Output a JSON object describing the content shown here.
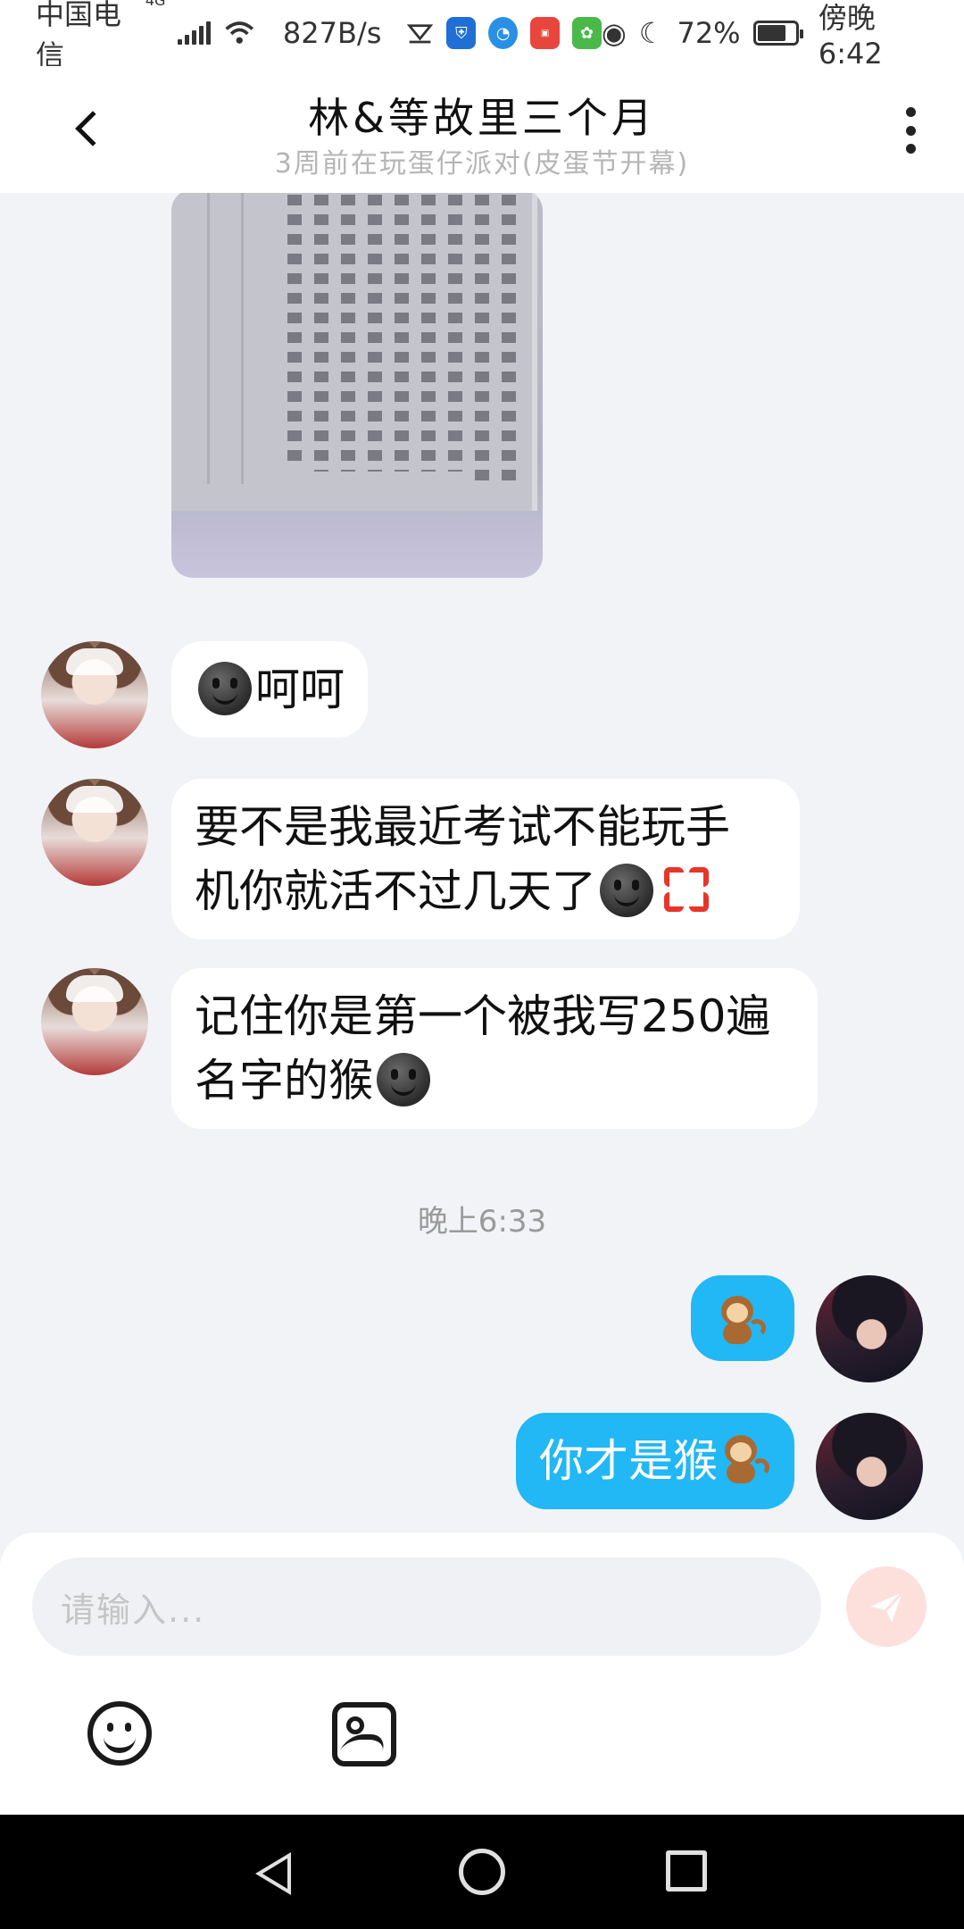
{
  "status_bar": {
    "carrier": "中国电信",
    "network_type": "4G",
    "data_speed": "827B/s",
    "battery_percent": "72%",
    "time": "傍晚6:42",
    "icons": [
      "signal-icon",
      "wifi-icon",
      "notification-icon",
      "shield-app-icon",
      "browser-app-icon",
      "huawei-app-icon",
      "game-app-icon",
      "eye-icon",
      "moon-icon",
      "battery-icon"
    ]
  },
  "header": {
    "title": "林&等故里三个月",
    "subtitle": "3周前在玩蛋仔派对(皮蛋节开幕)"
  },
  "messages": [
    {
      "from": "other",
      "type": "image",
      "alt": ""
    },
    {
      "from": "other",
      "type": "text",
      "text": "呵呵",
      "emojis": [
        "smile-emoji"
      ]
    },
    {
      "from": "other",
      "type": "text",
      "text_line1": "要不是我最近考试不能玩手",
      "text_line2": "机你就活不过几天了",
      "emojis": [
        "smile-emoji",
        "anger-emoji"
      ]
    },
    {
      "from": "other",
      "type": "text",
      "text_line1": "记住你是第一个被我写250遍",
      "text_line2": "名字的猴",
      "emojis": [
        "smile-emoji"
      ]
    },
    {
      "type": "timestamp",
      "text": "晚上6:33"
    },
    {
      "from": "me",
      "type": "emoji",
      "emojis": [
        "monkey-emoji"
      ]
    },
    {
      "from": "me",
      "type": "text",
      "text": "你才是猴",
      "emojis": [
        "monkey-emoji"
      ]
    }
  ],
  "input": {
    "placeholder": "请输入..."
  },
  "toolbar": {
    "icons": [
      "emoji-icon",
      "image-icon"
    ]
  },
  "colors": {
    "background": "#f2f3f7",
    "my_bubble": "#22b7f5",
    "other_bubble": "#ffffff",
    "send_button": "#fde0dc",
    "send_arrow": "#ffffff"
  }
}
